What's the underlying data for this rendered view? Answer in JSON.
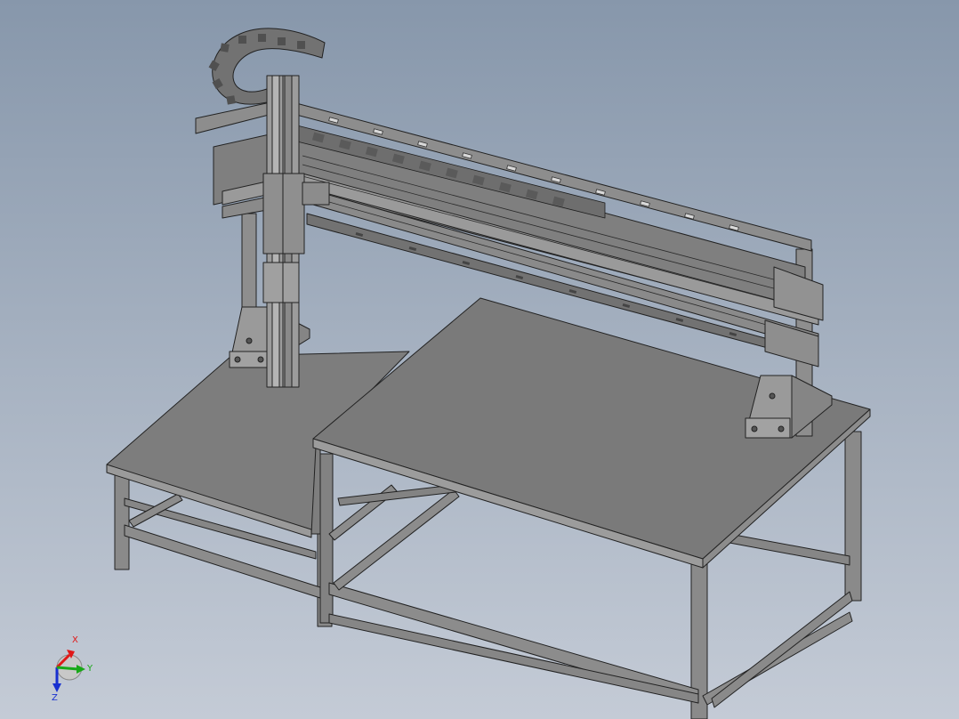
{
  "viewport": {
    "background_top": "#8797ab",
    "background_bottom": "#c4cbd6",
    "model_color": "#7a7a7a",
    "edge_color": "#222222"
  },
  "triad": {
    "x_label": "X",
    "y_label": "Y",
    "z_label": "Z",
    "x_color": "#e01818",
    "y_color": "#18a818",
    "z_color": "#1830d0"
  }
}
